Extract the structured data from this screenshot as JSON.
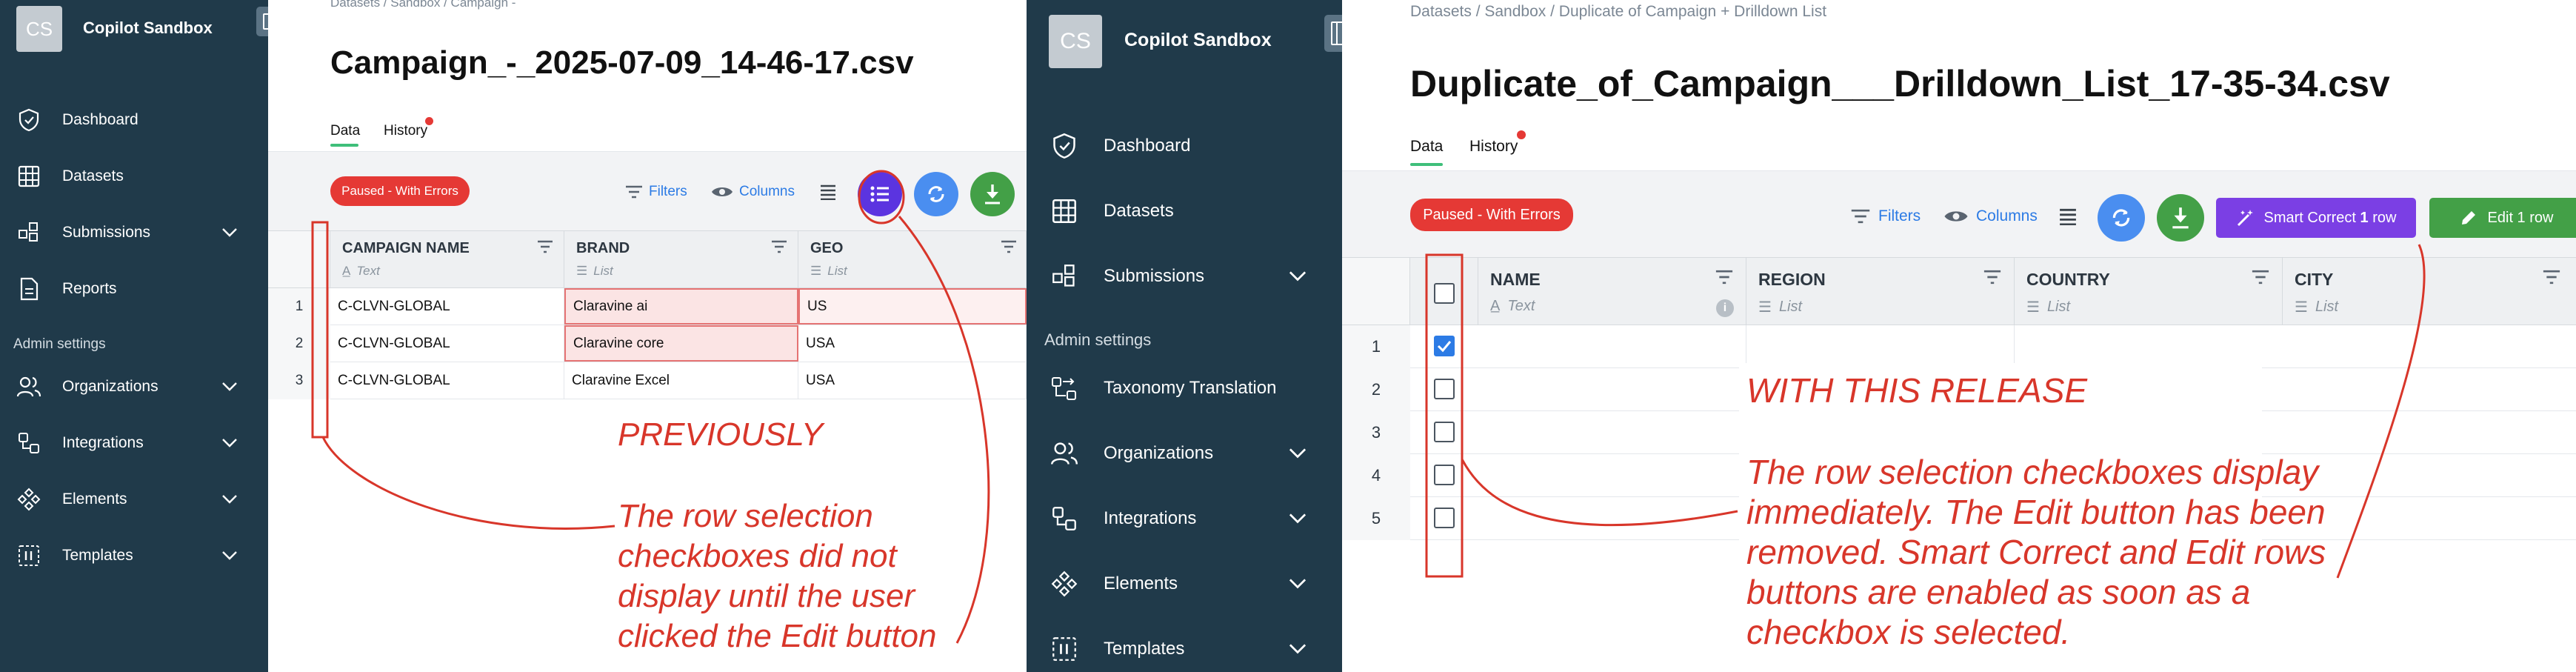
{
  "before": {
    "sidebar": {
      "avatar": "CS",
      "org_name": "Copilot Sandbox",
      "items": [
        {
          "label": "Dashboard",
          "icon": "shield-icon"
        },
        {
          "label": "Datasets",
          "icon": "table-icon"
        },
        {
          "label": "Submissions",
          "icon": "submissions-icon"
        },
        {
          "label": "Reports",
          "icon": "document-icon"
        }
      ],
      "section_label": "Admin settings",
      "admin_items": [
        {
          "label": "Organizations",
          "icon": "people-icon"
        },
        {
          "label": "Integrations",
          "icon": "integrations-icon"
        },
        {
          "label": "Elements",
          "icon": "elements-icon"
        },
        {
          "label": "Templates",
          "icon": "templates-icon"
        }
      ]
    },
    "breadcrumb": "Datasets  /  Sandbox  /  Campaign -",
    "file_title": "Campaign_-_2025-07-09_14-46-17.csv",
    "tabs": {
      "data": "Data",
      "history": "History"
    },
    "status": "Paused - With Errors",
    "toolbar": {
      "filters": "Filters",
      "columns": "Columns"
    },
    "columns": [
      {
        "name": "CAMPAIGN NAME",
        "type": "Text"
      },
      {
        "name": "BRAND",
        "type": "List"
      },
      {
        "name": "GEO",
        "type": "List"
      }
    ],
    "rows": [
      {
        "num": "1",
        "cells": [
          "C-CLVN-GLOBAL",
          "Claravine ai",
          "US"
        ]
      },
      {
        "num": "2",
        "cells": [
          "C-CLVN-GLOBAL",
          "Claravine core",
          "USA"
        ]
      },
      {
        "num": "3",
        "cells": [
          "C-CLVN-GLOBAL",
          "Claravine Excel",
          "USA"
        ]
      }
    ],
    "annotation": {
      "heading": "PREVIOUSLY",
      "lines": [
        "The row selection",
        "checkboxes did not",
        "display until the user",
        "clicked the Edit button"
      ]
    }
  },
  "after": {
    "sidebar": {
      "avatar": "CS",
      "org_name": "Copilot Sandbox",
      "items": [
        {
          "label": "Dashboard",
          "icon": "shield-icon"
        },
        {
          "label": "Datasets",
          "icon": "table-icon"
        },
        {
          "label": "Submissions",
          "icon": "submissions-icon"
        }
      ],
      "section_label": "Admin settings",
      "admin_items": [
        {
          "label": "Taxonomy Translation",
          "icon": "translation-icon"
        },
        {
          "label": "Organizations",
          "icon": "people-icon"
        },
        {
          "label": "Integrations",
          "icon": "integrations-icon"
        },
        {
          "label": "Elements",
          "icon": "elements-icon"
        },
        {
          "label": "Templates",
          "icon": "templates-icon"
        }
      ]
    },
    "breadcrumb": "Datasets  /  Sandbox  /  Duplicate of Campaign + Drilldown List",
    "file_title": "Duplicate_of_Campaign___Drilldown_List_17-35-34.csv",
    "tabs": {
      "data": "Data",
      "history": "History"
    },
    "status": "Paused - With Errors",
    "toolbar": {
      "filters": "Filters",
      "columns": "Columns",
      "smart_correct_pre": "Smart Correct ",
      "smart_correct_num": "1",
      "smart_correct_post": " row",
      "edit": "Edit 1 row"
    },
    "columns": [
      {
        "name": "NAME",
        "type": "Text"
      },
      {
        "name": "REGION",
        "type": "List"
      },
      {
        "name": "COUNTRY",
        "type": "List"
      },
      {
        "name": "CITY",
        "type": "List"
      }
    ],
    "rows": [
      {
        "num": "1",
        "checked": true
      },
      {
        "num": "2",
        "checked": false
      },
      {
        "num": "3",
        "checked": false
      },
      {
        "num": "4",
        "checked": false
      },
      {
        "num": "5",
        "checked": false
      }
    ],
    "annotation": {
      "heading": "WITH THIS RELEASE",
      "lines": [
        "The row selection checkboxes display",
        "immediately. The Edit button has been",
        "removed. Smart Correct and Edit rows",
        "buttons are enabled as soon as a",
        "checkbox is selected."
      ]
    }
  },
  "colors": {
    "sidebar": "#203a4a",
    "error": "#e53935",
    "annotation": "#d8362a",
    "purple": "#5b34e0",
    "blue": "#4a8ef0",
    "green": "#43a047",
    "smart_correct": "#7b3fe4"
  }
}
